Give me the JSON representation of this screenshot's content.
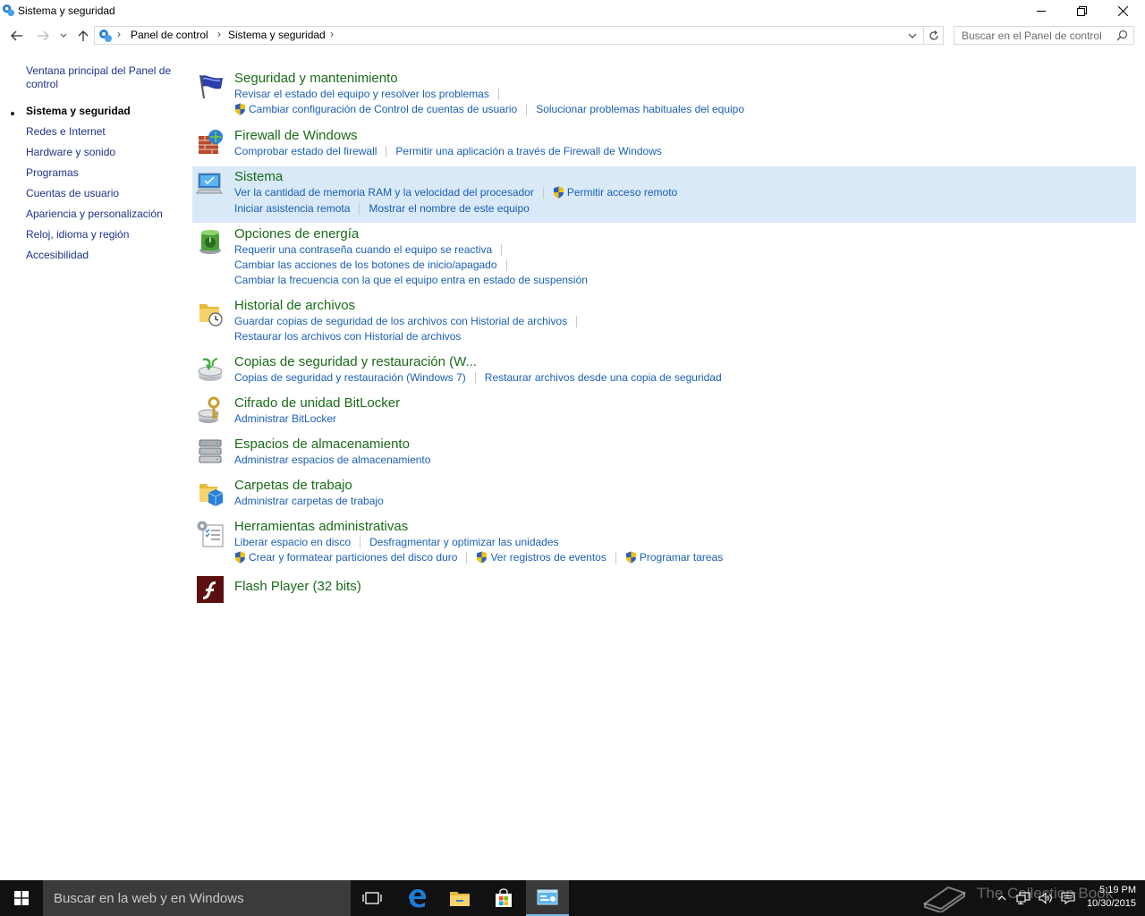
{
  "window": {
    "title": "Sistema y seguridad"
  },
  "address": {
    "crumbs": [
      "Panel de control",
      "Sistema y seguridad"
    ],
    "search_placeholder": "Buscar en el Panel de control"
  },
  "leftnav": {
    "home": "Ventana principal del Panel de control",
    "items": [
      "Sistema y seguridad",
      "Redes e Internet",
      "Hardware y sonido",
      "Programas",
      "Cuentas de usuario",
      "Apariencia y personalización",
      "Reloj, idioma y región",
      "Accesibilidad"
    ]
  },
  "categories": {
    "security": {
      "title": "Seguridad y mantenimiento",
      "links": [
        "Revisar el estado del equipo y resolver los problemas",
        "Cambiar configuración de Control de cuentas de usuario",
        "Solucionar problemas habituales del equipo"
      ]
    },
    "firewall": {
      "title": "Firewall de Windows",
      "links": [
        "Comprobar estado del firewall",
        "Permitir una aplicación a través de Firewall de Windows"
      ]
    },
    "system": {
      "title": "Sistema",
      "links": [
        "Ver la cantidad de memoria RAM y la velocidad del procesador",
        "Permitir acceso remoto",
        "Iniciar asistencia remota",
        "Mostrar el nombre de este equipo"
      ]
    },
    "power": {
      "title": "Opciones de energía",
      "links": [
        "Requerir una contraseña cuando el equipo se reactiva",
        "Cambiar las acciones de los botones de inicio/apagado",
        "Cambiar la frecuencia con la que el equipo entra en estado de suspensión"
      ]
    },
    "filehistory": {
      "title": "Historial de archivos",
      "links": [
        "Guardar copias de seguridad de los archivos con Historial de archivos",
        "Restaurar los archivos con Historial de archivos"
      ]
    },
    "backup": {
      "title": "Copias de seguridad y restauración (W...",
      "links": [
        "Copias de seguridad y restauración (Windows 7)",
        "Restaurar archivos desde una copia de seguridad"
      ]
    },
    "bitlocker": {
      "title": "Cifrado de unidad BitLocker",
      "links": [
        "Administrar BitLocker"
      ]
    },
    "storage": {
      "title": "Espacios de almacenamiento",
      "links": [
        "Administrar espacios de almacenamiento"
      ]
    },
    "workfolders": {
      "title": "Carpetas de trabajo",
      "links": [
        "Administrar carpetas de trabajo"
      ]
    },
    "admintools": {
      "title": "Herramientas administrativas",
      "links": [
        "Liberar espacio en disco",
        "Desfragmentar y optimizar las unidades",
        "Crear y formatear particiones del disco duro",
        "Ver registros de eventos",
        "Programar tareas"
      ]
    },
    "flash": {
      "title": "Flash Player (32 bits)"
    }
  },
  "taskbar": {
    "search_placeholder": "Buscar en la web y en Windows",
    "time": "5:19 PM",
    "date": "10/30/2015",
    "watermark": "The Collection Book"
  },
  "colors": {
    "category_title": "#1a6b1a",
    "link": "#1a5fb4",
    "highlight": "#d9e9f7",
    "taskbar": "#111111"
  }
}
